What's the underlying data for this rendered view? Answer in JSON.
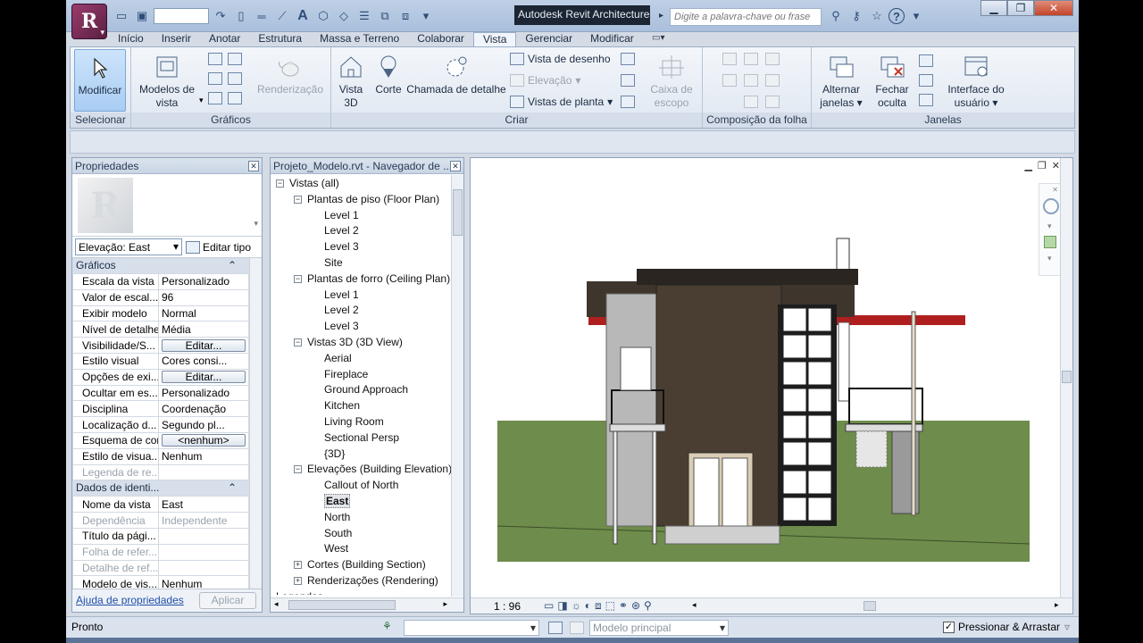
{
  "app": {
    "title": "Autodesk Revit Architecture",
    "logo": "R"
  },
  "search": {
    "placeholder": "Digite a palavra-chave ou frase"
  },
  "tabs": [
    "Início",
    "Inserir",
    "Anotar",
    "Estrutura",
    "Massa e Terreno",
    "Colaborar",
    "Vista",
    "Gerenciar",
    "Modificar"
  ],
  "active_tab": "Vista",
  "ribbon": {
    "selecionar": {
      "title": "Selecionar",
      "modificar": "Modificar"
    },
    "graficos": {
      "title": "Gráficos",
      "modelos_line1": "Modelos de",
      "modelos_line2": "vista"
    },
    "apresentacao": {
      "renderizacao": "Renderização"
    },
    "criar": {
      "title": "Criar",
      "vista3d_line1": "Vista",
      "vista3d_line2": "3D",
      "corte": "Corte",
      "chamada": "Chamada de detalhe",
      "vista_desenho": "Vista de desenho",
      "elevacao": "Elevação",
      "vistas_planta": "Vistas de planta",
      "caixa_line1": "Caixa de",
      "caixa_line2": "escopo"
    },
    "composicao": {
      "title": "Composição da folha"
    },
    "janelas": {
      "title": "Janelas",
      "alternar_line1": "Alternar",
      "alternar_line2": "janelas",
      "fechar_line1": "Fechar",
      "fechar_line2": "oculta",
      "interface_line1": "Interface do",
      "interface_line2": "usuário"
    }
  },
  "properties": {
    "title": "Propriedades",
    "type_selector": "Elevação: East",
    "edit_type": "Editar tipo",
    "section_graphics": "Gráficos",
    "graphics_rows": [
      {
        "key": "Escala da vista",
        "value": "Personalizado"
      },
      {
        "key": "Valor de escal...",
        "value": "96"
      },
      {
        "key": "Exibir modelo",
        "value": "Normal"
      },
      {
        "key": "Nível de detalhe",
        "value": "Média"
      },
      {
        "key": "Visibilidade/S...",
        "value": "Editar..."
      },
      {
        "key": "Estilo visual",
        "value": "Cores consi..."
      },
      {
        "key": "Opções de exi...",
        "value": "Editar..."
      },
      {
        "key": "Ocultar em es...",
        "value": "Personalizado"
      },
      {
        "key": "Disciplina",
        "value": "Coordenação"
      },
      {
        "key": "Localização d...",
        "value": "Segundo pl..."
      },
      {
        "key": "Esquema de cor",
        "value": "<nenhum>"
      },
      {
        "key": "Estilo de visua...",
        "value": "Nenhum"
      },
      {
        "key": "Legenda de re...",
        "value": ""
      }
    ],
    "section_identity": "Dados de identi...",
    "identity_rows": [
      {
        "key": "Nome da vista",
        "value": "East"
      },
      {
        "key": "Dependência",
        "value": "Independente"
      },
      {
        "key": "Título da pági...",
        "value": ""
      },
      {
        "key": "Folha de refer...",
        "value": ""
      },
      {
        "key": "Detalhe de ref...",
        "value": ""
      },
      {
        "key": "Modelo de vis...",
        "value": "Nenhum"
      }
    ],
    "help_link": "Ajuda de propriedades",
    "apply": "Aplicar"
  },
  "browser": {
    "title": "Projeto_Modelo.rvt - Navegador de ...",
    "nodes": [
      {
        "label": "Vistas (all)",
        "level": 0,
        "box": "−"
      },
      {
        "label": "Plantas de piso (Floor Plan)",
        "level": 1,
        "box": "−"
      },
      {
        "label": "Level 1",
        "level": 2
      },
      {
        "label": "Level 2",
        "level": 2
      },
      {
        "label": "Level 3",
        "level": 2
      },
      {
        "label": "Site",
        "level": 2
      },
      {
        "label": "Plantas de forro (Ceiling Plan)",
        "level": 1,
        "box": "−"
      },
      {
        "label": "Level 1",
        "level": 2
      },
      {
        "label": "Level 2",
        "level": 2
      },
      {
        "label": "Level 3",
        "level": 2
      },
      {
        "label": "Vistas 3D (3D View)",
        "level": 1,
        "box": "−"
      },
      {
        "label": "Aerial",
        "level": 2
      },
      {
        "label": "Fireplace",
        "level": 2
      },
      {
        "label": "Ground Approach",
        "level": 2
      },
      {
        "label": "Kitchen",
        "level": 2
      },
      {
        "label": "Living Room",
        "level": 2
      },
      {
        "label": "Sectional Persp",
        "level": 2
      },
      {
        "label": "{3D}",
        "level": 2
      },
      {
        "label": "Elevações (Building Elevation)",
        "level": 1,
        "box": "−"
      },
      {
        "label": "Callout of North",
        "level": 2
      },
      {
        "label": "East",
        "level": 2,
        "selected": true
      },
      {
        "label": "North",
        "level": 2
      },
      {
        "label": "South",
        "level": 2
      },
      {
        "label": "West",
        "level": 2
      },
      {
        "label": "Cortes (Building Section)",
        "level": 1,
        "box": "+"
      },
      {
        "label": "Renderizações (Rendering)",
        "level": 1,
        "box": "+"
      },
      {
        "label": "Legendas",
        "level": 0
      }
    ]
  },
  "view": {
    "scale": "1 : 96"
  },
  "status": {
    "text": "Pronto",
    "model": "Modelo principal",
    "press_drag": "Pressionar & Arrastar"
  },
  "colors": {
    "accent": "#a9cdf3",
    "grass": "#6e8c4b",
    "wall": "#3e352c",
    "roof_beam": "#b01f1f"
  }
}
